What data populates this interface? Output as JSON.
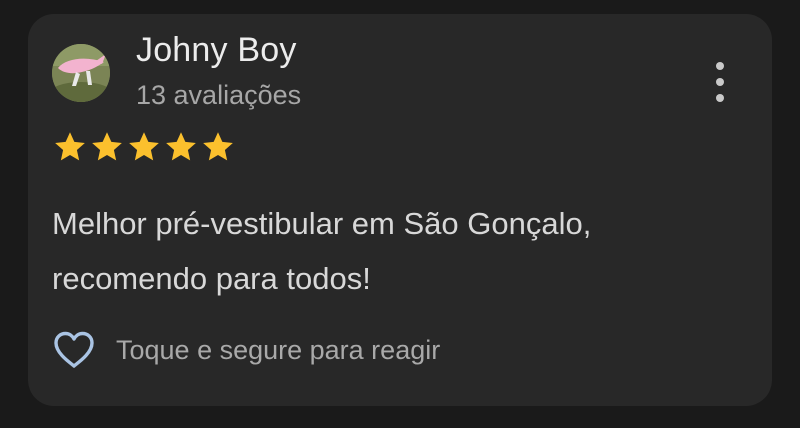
{
  "review": {
    "author": {
      "name": "Johny Boy",
      "review_count": "13 avaliações",
      "avatar_icon": "profile-photo"
    },
    "rating": 5,
    "rating_max": 5,
    "star_color": "#fbc02d",
    "text": "Melhor pré-vestibular em São Gonçalo, recomendo para todos!",
    "more_icon": "more-vertical-icon",
    "react": {
      "icon": "heart-outline-icon",
      "label": "Toque e segure para reagir"
    }
  }
}
